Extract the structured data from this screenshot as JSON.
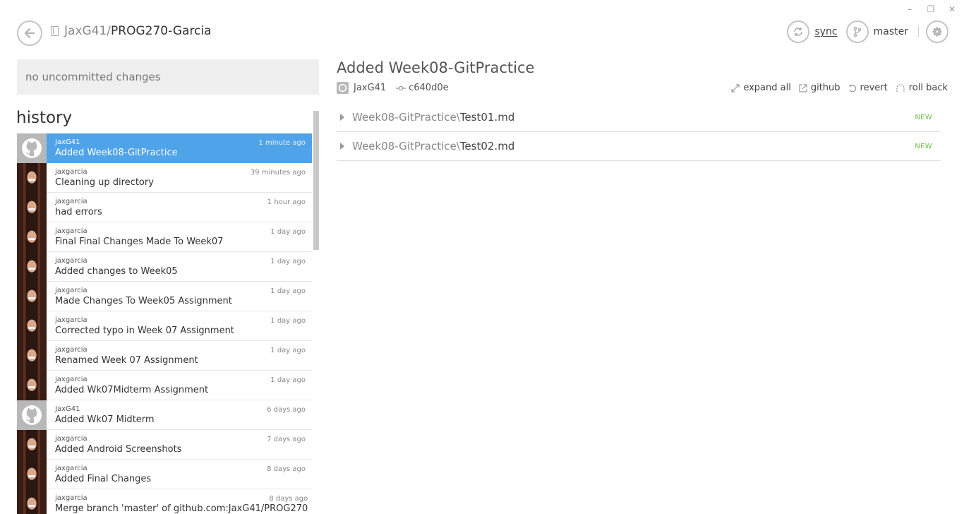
{
  "window": {
    "minimize": "–",
    "restore": "❐",
    "close": "✕"
  },
  "header": {
    "repo_owner": "JaxG41",
    "repo_sep": "/",
    "repo_name": "PROG270-Garcia",
    "sync_label": "sync",
    "branch_label": "master"
  },
  "left": {
    "uncommitted": "no uncommitted changes",
    "history_title": "history",
    "commits": [
      {
        "author": "JaxG41",
        "message": "Added Week08-GitPractice",
        "when": "1 minute ago",
        "avatar": "github-octocat",
        "selected": true
      },
      {
        "author": "jaxgarcia",
        "message": "Cleaning up directory",
        "when": "39 minutes ago",
        "avatar": "photo"
      },
      {
        "author": "jaxgarcia",
        "message": "had errors",
        "when": "1 hour ago",
        "avatar": "photo"
      },
      {
        "author": "jaxgarcia",
        "message": "Final Final Changes Made To Week07",
        "when": "1 day ago",
        "avatar": "photo"
      },
      {
        "author": "jaxgarcia",
        "message": "Added changes to Week05",
        "when": "1 day ago",
        "avatar": "photo"
      },
      {
        "author": "jaxgarcia",
        "message": "Made Changes To Week05 Assignment",
        "when": "1 day ago",
        "avatar": "photo"
      },
      {
        "author": "jaxgarcia",
        "message": "Corrected typo in Week 07 Assignment",
        "when": "1 day ago",
        "avatar": "photo"
      },
      {
        "author": "jaxgarcia",
        "message": "Renamed Week 07 Assignment",
        "when": "1 day ago",
        "avatar": "photo"
      },
      {
        "author": "jaxgarcia",
        "message": "Added Wk07Midterm Assignment",
        "when": "1 day ago",
        "avatar": "photo"
      },
      {
        "author": "JaxG41",
        "message": "Added Wk07 Midterm",
        "when": "6 days ago",
        "avatar": "github-octocat"
      },
      {
        "author": "jaxgarcia",
        "message": "Added Android Screenshots",
        "when": "7 days ago",
        "avatar": "photo"
      },
      {
        "author": "jaxgarcia",
        "message": "Added Final Changes",
        "when": "8 days ago",
        "avatar": "photo"
      },
      {
        "author": "jaxgarcia",
        "message": "Merge branch 'master' of github.com:JaxG41/PROG270",
        "when": "8 days ago",
        "avatar": "photo"
      }
    ]
  },
  "detail": {
    "title": "Added Week08-GitPractice",
    "author": "JaxG41",
    "sha": "c640d0e",
    "actions": {
      "expand_all": "expand all",
      "github": "github",
      "revert": "revert",
      "roll_back": "roll back"
    },
    "files": [
      {
        "dir": "Week08-GitPractice\\",
        "name": "Test01.md",
        "status": "NEW"
      },
      {
        "dir": "Week08-GitPractice\\",
        "name": "Test02.md",
        "status": "NEW"
      }
    ]
  },
  "colors": {
    "selected": "#4fa3e8",
    "new_badge": "#6cc04a"
  }
}
